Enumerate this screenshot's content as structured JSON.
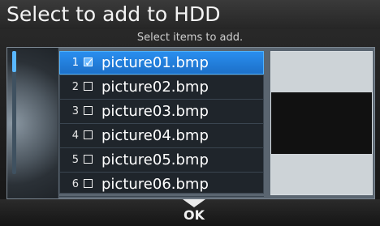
{
  "header": {
    "title": "Select to add to HDD"
  },
  "subheader": {
    "instruction": "Select items to add."
  },
  "list": {
    "items": [
      {
        "index": "1",
        "name": "picture01.bmp",
        "checked": true,
        "selected": true
      },
      {
        "index": "2",
        "name": "picture02.bmp",
        "checked": false,
        "selected": false
      },
      {
        "index": "3",
        "name": "picture03.bmp",
        "checked": false,
        "selected": false
      },
      {
        "index": "4",
        "name": "picture04.bmp",
        "checked": false,
        "selected": false
      },
      {
        "index": "5",
        "name": "picture05.bmp",
        "checked": false,
        "selected": false
      },
      {
        "index": "6",
        "name": "picture06.bmp",
        "checked": false,
        "selected": false
      }
    ]
  },
  "footer": {
    "ok_label": "OK"
  },
  "colors": {
    "accent": "#2a8ff0",
    "background": "#151515",
    "panel": "#5a6570"
  }
}
